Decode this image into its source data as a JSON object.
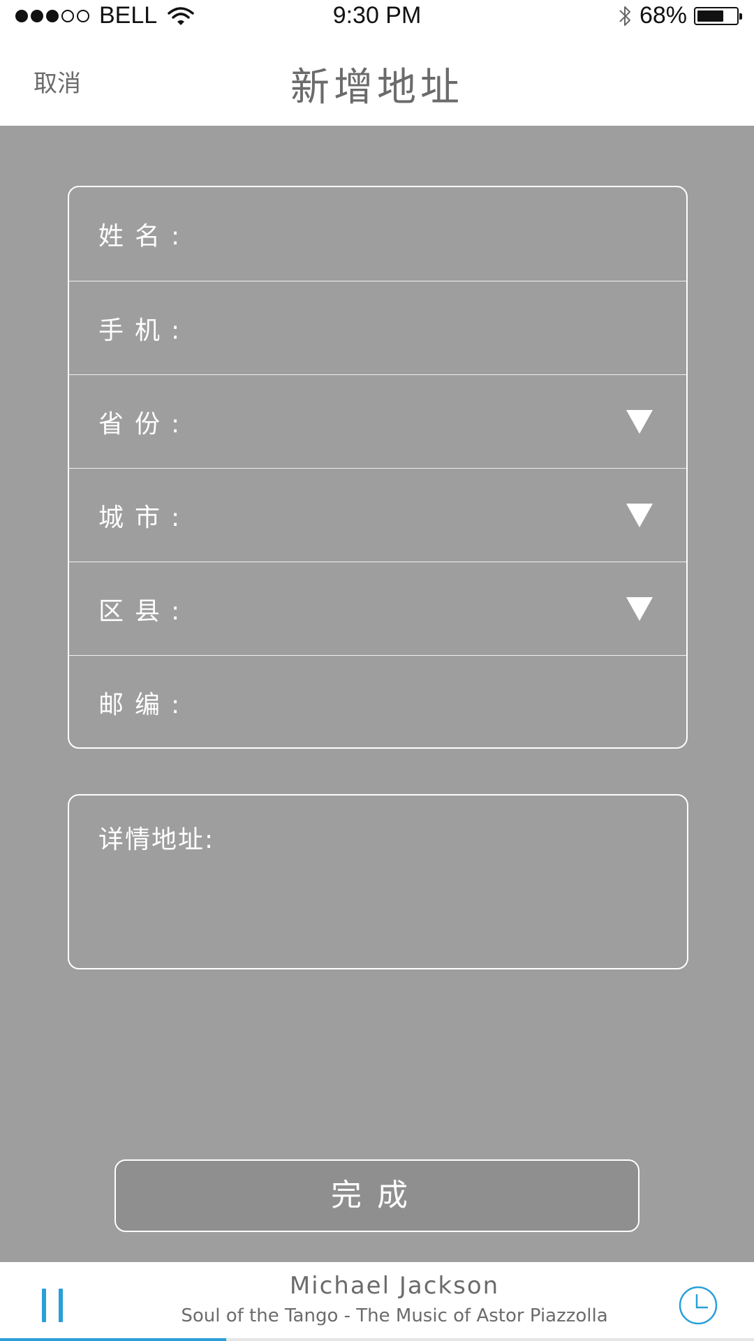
{
  "status_bar": {
    "carrier": "BELL",
    "signal_bars": 3,
    "signal_total": 5,
    "time": "9:30 PM",
    "battery_percent": "68%",
    "battery_level": 0.68
  },
  "nav": {
    "cancel_label": "取消",
    "title": "新增地址"
  },
  "form": {
    "fields": [
      {
        "label": "姓名:",
        "dropdown": false
      },
      {
        "label": "手机:",
        "dropdown": false
      },
      {
        "label": "省份:",
        "dropdown": true
      },
      {
        "label": "城市:",
        "dropdown": true
      },
      {
        "label": "区县:",
        "dropdown": true
      },
      {
        "label": "邮编:",
        "dropdown": false
      }
    ],
    "address_label": "详情地址:"
  },
  "done_label": "完成",
  "player": {
    "artist": "Michael Jackson",
    "track": "Soul of the Tango - The Music of Astor Piazzolla",
    "progress": 0.3
  },
  "colors": {
    "background": "#9e9e9e",
    "accent": "#2a9fd8",
    "header_text": "#6b6b6b"
  }
}
